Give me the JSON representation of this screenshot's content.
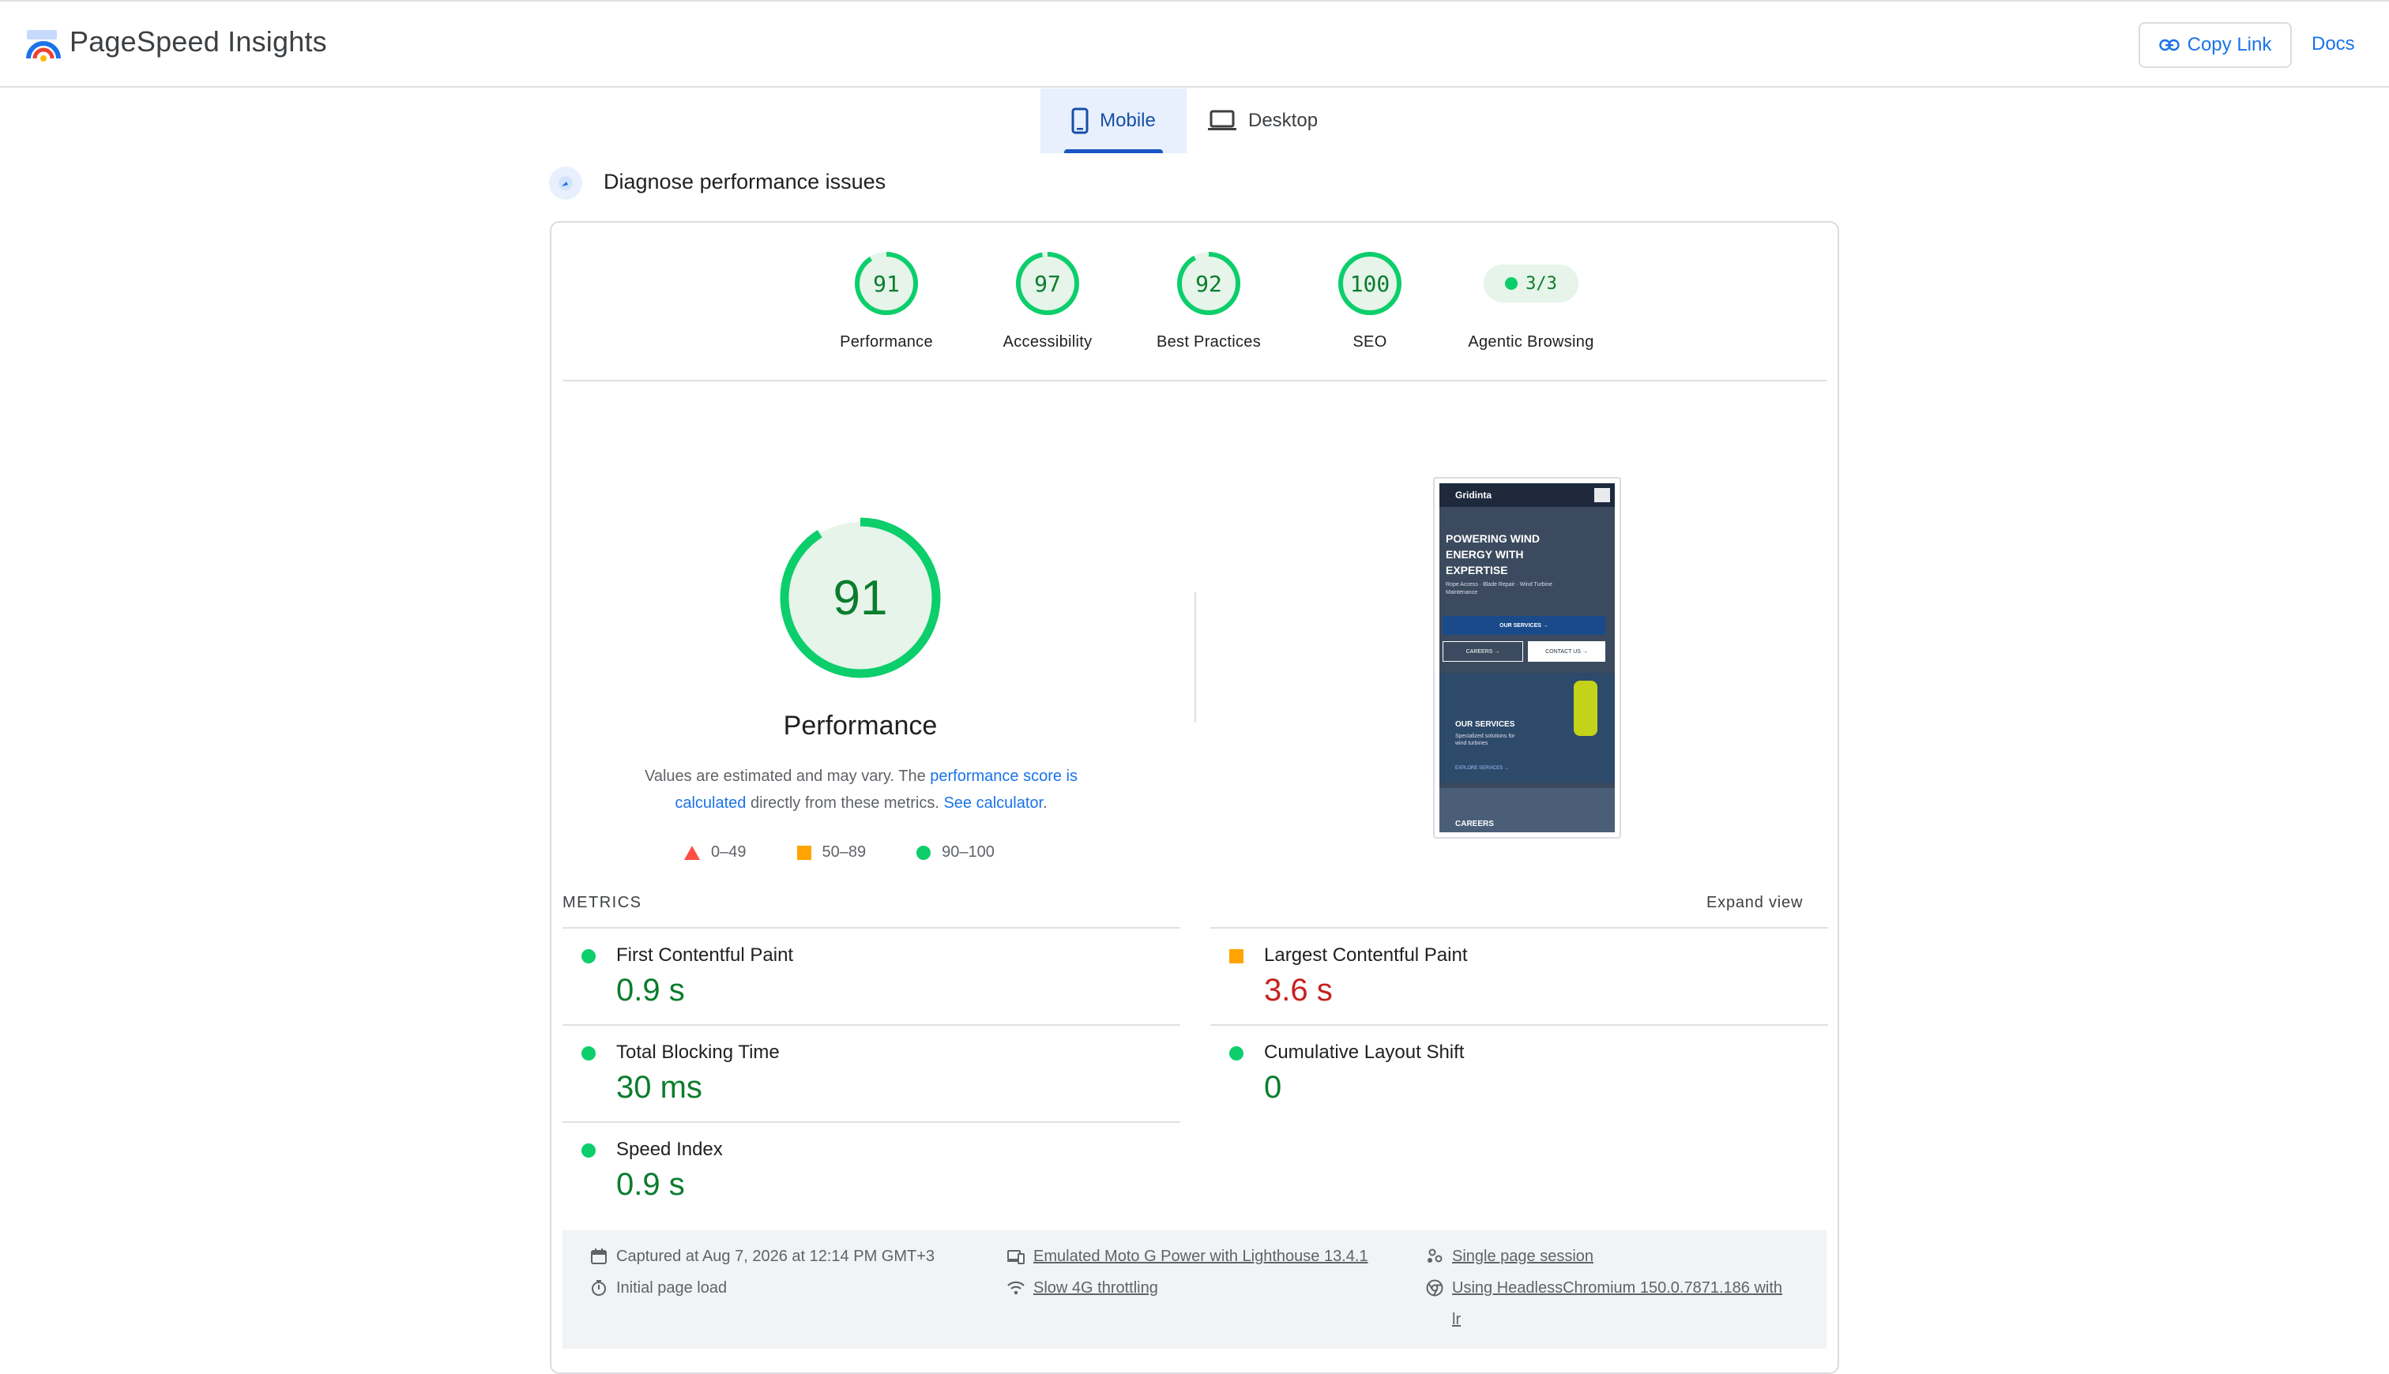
{
  "header": {
    "app_title": "PageSpeed Insights",
    "copy_link_label": "Copy Link",
    "docs_label": "Docs"
  },
  "tabs": [
    {
      "label": "Mobile",
      "active": true,
      "icon": "phone-icon"
    },
    {
      "label": "Desktop",
      "active": false,
      "icon": "laptop-icon"
    }
  ],
  "diagnose_title": "Diagnose performance issues",
  "scores": [
    {
      "value": "91",
      "label": "Performance",
      "fraction": 0.91
    },
    {
      "value": "97",
      "label": "Accessibility",
      "fraction": 0.97
    },
    {
      "value": "92",
      "label": "Best Practices",
      "fraction": 0.92
    },
    {
      "value": "100",
      "label": "SEO",
      "fraction": 1.0
    }
  ],
  "agentic": {
    "value": "3/3",
    "label": "Agentic Browsing"
  },
  "performance": {
    "score": "91",
    "fraction": 0.91,
    "title": "Performance",
    "note_prefix": "Values are estimated and may vary. The ",
    "note_link1": "performance score is calculated",
    "note_mid": " directly from these metrics. ",
    "note_link2": "See calculator",
    "note_suffix": "."
  },
  "legend": [
    {
      "range": "0–49",
      "color": "#ff4e42",
      "shape": "triangle"
    },
    {
      "range": "50–89",
      "color": "#ffa400",
      "shape": "square"
    },
    {
      "range": "90–100",
      "color": "#0cce6b",
      "shape": "circle"
    }
  ],
  "screenshot": {
    "brand": "Gridinta",
    "hero": "POWERING WIND ENERGY WITH EXPERTISE",
    "hero_sub": "Rope Access · Blade Repair · Wind Turbine Maintenance",
    "btn_services": "OUR SERVICES  →",
    "btn_careers": "CAREERS  →",
    "btn_contact": "CONTACT US  →",
    "services_title": "OUR SERVICES",
    "services_sub": "Specialized solutions for wind turbines",
    "explore": "EXPLORE SERVICES  →",
    "careers_title": "CAREERS"
  },
  "metrics": {
    "heading": "METRICS",
    "expand_label": "Expand view",
    "items": [
      {
        "label": "First Contentful Paint",
        "value": "0.9 s",
        "status": "good"
      },
      {
        "label": "Largest Contentful Paint",
        "value": "3.6 s",
        "status": "average"
      },
      {
        "label": "Total Blocking Time",
        "value": "30 ms",
        "status": "good"
      },
      {
        "label": "Cumulative Layout Shift",
        "value": "0",
        "status": "good"
      },
      {
        "label": "Speed Index",
        "value": "0.9 s",
        "status": "good"
      }
    ]
  },
  "footer": {
    "captured": "Captured at Aug 7, 2026 at 12:14 PM GMT+3",
    "initial_load": "Initial page load",
    "device": "Emulated Moto G Power with Lighthouse 13.4.1",
    "throttling": "Slow 4G throttling",
    "session": "Single page session",
    "browser_line1": "Using HeadlessChromium 150.0.7871.186 with",
    "browser_line2": "lr"
  },
  "colors": {
    "good": "#0cce6b",
    "good_text": "#0a7d2c",
    "average": "#ffa400",
    "poor": "#ff4e42",
    "accent": "#1a73e8"
  }
}
